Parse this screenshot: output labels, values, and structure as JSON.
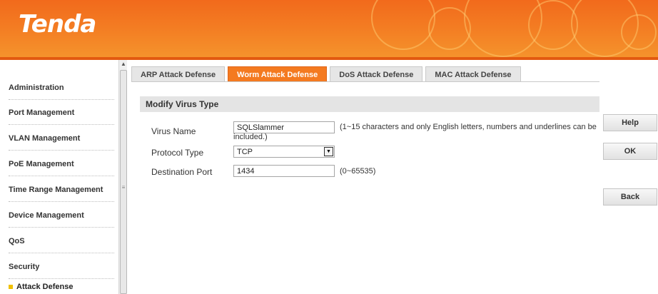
{
  "brand": {
    "logo": "Tenda",
    "accent": "#f47a20"
  },
  "sidebar": {
    "items": [
      {
        "label": "Administration"
      },
      {
        "label": "Port Management"
      },
      {
        "label": "VLAN Management"
      },
      {
        "label": "PoE Management"
      },
      {
        "label": "Time Range Management"
      },
      {
        "label": "Device Management"
      },
      {
        "label": "QoS"
      },
      {
        "label": "Security"
      },
      {
        "label": "Attack Defense"
      }
    ]
  },
  "tabs": [
    {
      "label": "ARP Attack Defense",
      "active": false
    },
    {
      "label": "Worm Attack Defense",
      "active": true
    },
    {
      "label": "DoS Attack Defense",
      "active": false
    },
    {
      "label": "MAC Attack Defense",
      "active": false
    }
  ],
  "form": {
    "title": "Modify Virus Type",
    "virus_name": {
      "label": "Virus Name",
      "value": "SQLSlammer",
      "hint_line1": "(1~15 characters and only English letters, numbers and underlines can be",
      "hint_line2": "included.)"
    },
    "protocol": {
      "label": "Protocol Type",
      "value": "TCP"
    },
    "port": {
      "label": "Destination Port",
      "value": "1434",
      "hint": "(0~65535)"
    }
  },
  "buttons": {
    "help": "Help",
    "ok": "OK",
    "back": "Back"
  }
}
